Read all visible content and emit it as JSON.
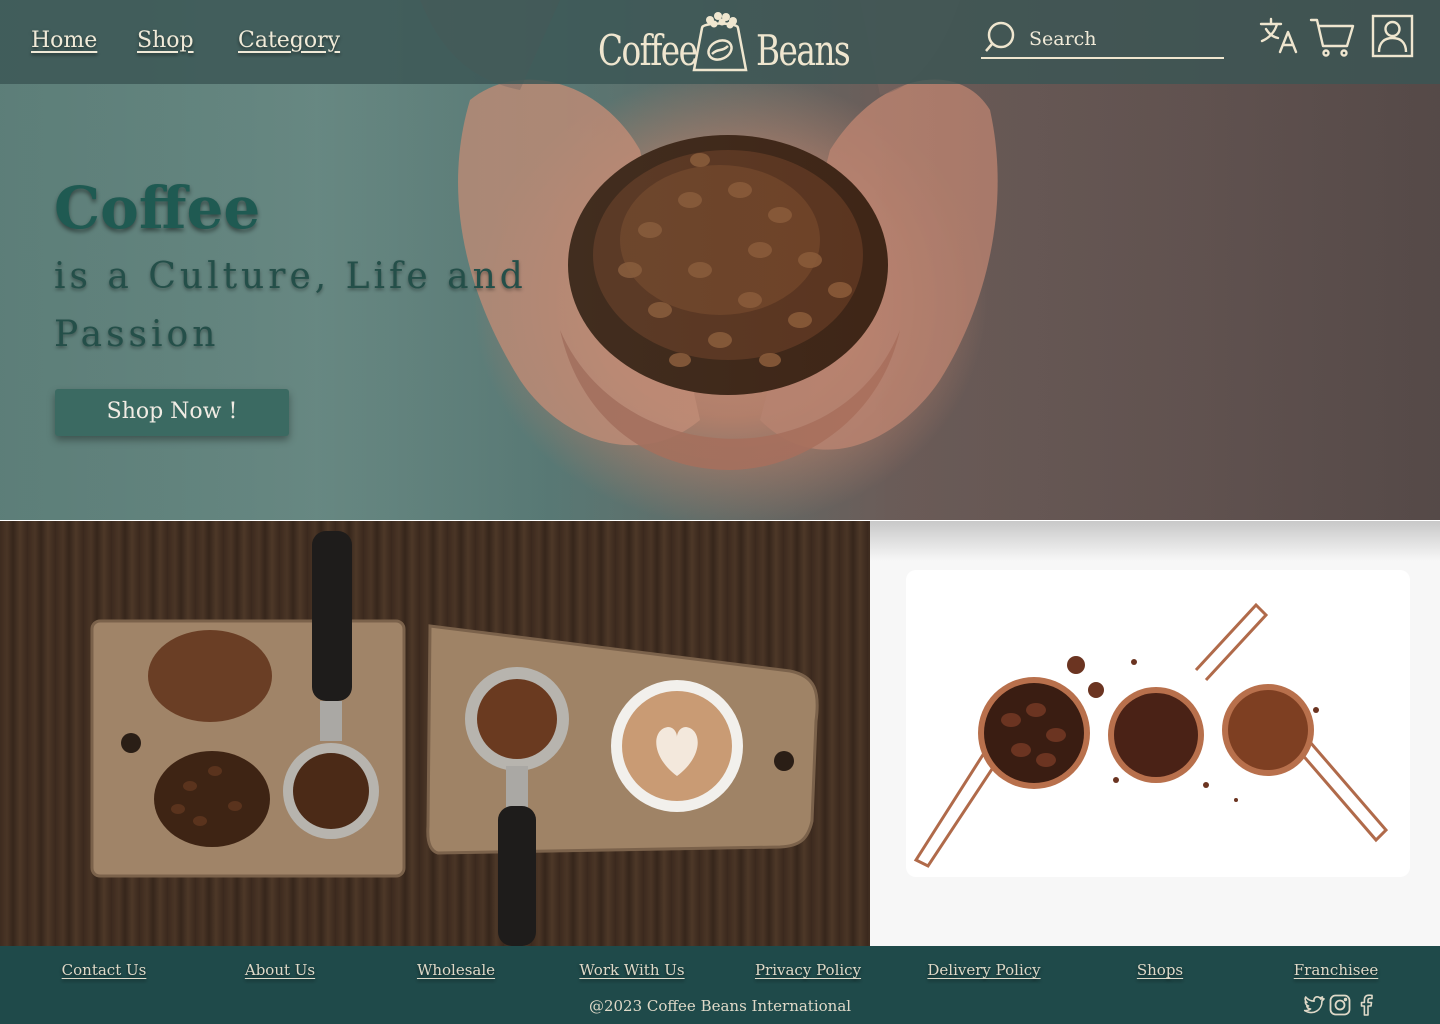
{
  "nav": {
    "links": [
      "Home",
      "Shop",
      "Category"
    ],
    "brand": {
      "left": "Coffee",
      "right": "Beans"
    },
    "search": {
      "placeholder": "Search"
    },
    "icons": [
      "translate-icon",
      "cart-icon",
      "user-icon"
    ]
  },
  "hero": {
    "title": "Coffee",
    "subtitle": "is a Culture, Life and Passion",
    "cta": "Shop Now !"
  },
  "footer": {
    "links": [
      "Contact Us",
      "About Us",
      "Wholesale",
      "Work With Us",
      "Privacy Policy",
      "Delivery Policy",
      "Shops",
      "Franchisee"
    ],
    "copyright": "@2023 Coffee Beans International",
    "social_icons": [
      "twitter-icon",
      "instagram-icon",
      "facebook-icon"
    ]
  },
  "colors": {
    "nav_bg": "#3a5654",
    "accent": "#3b6a62",
    "footer_bg": "#1f4a4a",
    "heading": "#1f5a52",
    "cream_text": "#f0ead8"
  }
}
